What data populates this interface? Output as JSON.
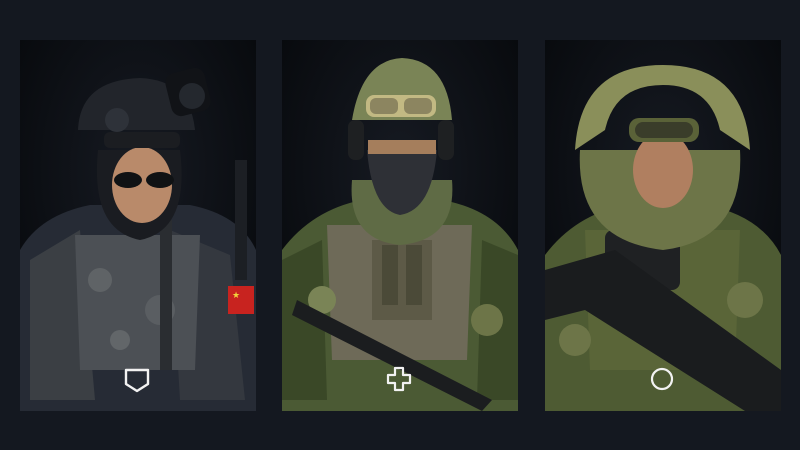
{
  "screen": {
    "background": "#141820",
    "card_background": "#07090d"
  },
  "operators": [
    {
      "role_icon": "shield-icon",
      "accent": "#c8231f",
      "palette": {
        "uniform": "#2a2f3a",
        "gear": "#3d4148",
        "camo": "#5b5f62",
        "skin": "#b98a6a"
      }
    },
    {
      "role_icon": "plus-icon",
      "accent": "#c8231f",
      "palette": {
        "uniform": "#4b5a34",
        "gear": "#5f6b45",
        "camo": "#7a8456",
        "skin": "#a57e5c"
      }
    },
    {
      "role_icon": "circle-icon",
      "accent": "#6f7a48",
      "palette": {
        "uniform": "#4e5b33",
        "gear": "#6d7548",
        "camo": "#8a8f5a",
        "skin": "#b07f60"
      }
    }
  ]
}
